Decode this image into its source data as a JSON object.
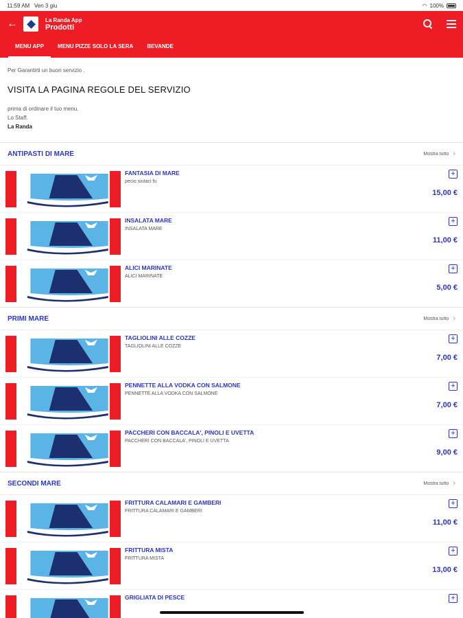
{
  "status": {
    "time": "11:59 AM",
    "date": "Ven 3 giu",
    "battery": "100%"
  },
  "header": {
    "app_name": "La Randa App",
    "page_title": "Prodotti"
  },
  "tabs": [
    {
      "label": "MENU APP",
      "active": true
    },
    {
      "label": "MENU PIZZE SOLO LA SERA",
      "active": false
    },
    {
      "label": "BEVANDE",
      "active": false
    }
  ],
  "intro": {
    "line1": "Per Garantirti un buon servizio .",
    "heading": "VISITA LA PAGINA REGOLE DEL SERVIZIO",
    "line2": "prima di ordinare il tuo menu.",
    "line3": "Lo Staff.",
    "signature": "La Randa"
  },
  "show_all_label": "Mostra tutto",
  "sections": [
    {
      "title": "ANTIPASTI DI MARE",
      "products": [
        {
          "name": "FANTASIA DI MARE",
          "desc": "pecio siutaci fu",
          "price": "15,00 €"
        },
        {
          "name": "INSALATA MARE",
          "desc": "INSALATA MARE",
          "price": "11,00 €"
        },
        {
          "name": "ALICI MARINATE",
          "desc": "ALICI MARINATE",
          "price": "5,00 €"
        }
      ]
    },
    {
      "title": "PRIMI MARE",
      "products": [
        {
          "name": "TAGLIOLINI ALLE COZZE",
          "desc": "TAGLIOLINI ALLE COZZE",
          "price": "7,00 €"
        },
        {
          "name": "PENNETTE ALLA VODKA CON SALMONE",
          "desc": "PENNETTE ALLA VODKA CON SALMONE",
          "price": "7,00 €"
        },
        {
          "name": "PACCHERI CON BACCALA', PINOLI E UVETTA",
          "desc": "PACCHERI CON BACCALA', PINOLI E UVETTA",
          "price": "9,00 €"
        }
      ]
    },
    {
      "title": "SECONDI MARE",
      "products": [
        {
          "name": "FRITTURA CALAMARI E GAMBERI",
          "desc": "FRITTURA CALAMARI E GAMBERI",
          "price": "11,00 €"
        },
        {
          "name": "FRITTURA MISTA",
          "desc": "FRITTURA MISTA",
          "price": "13,00 €"
        },
        {
          "name": "GRIGLIATA DI PESCE",
          "desc": "",
          "price": ""
        }
      ]
    }
  ],
  "colors": {
    "brand": "#ee1c25",
    "accent": "#2b35c7"
  }
}
